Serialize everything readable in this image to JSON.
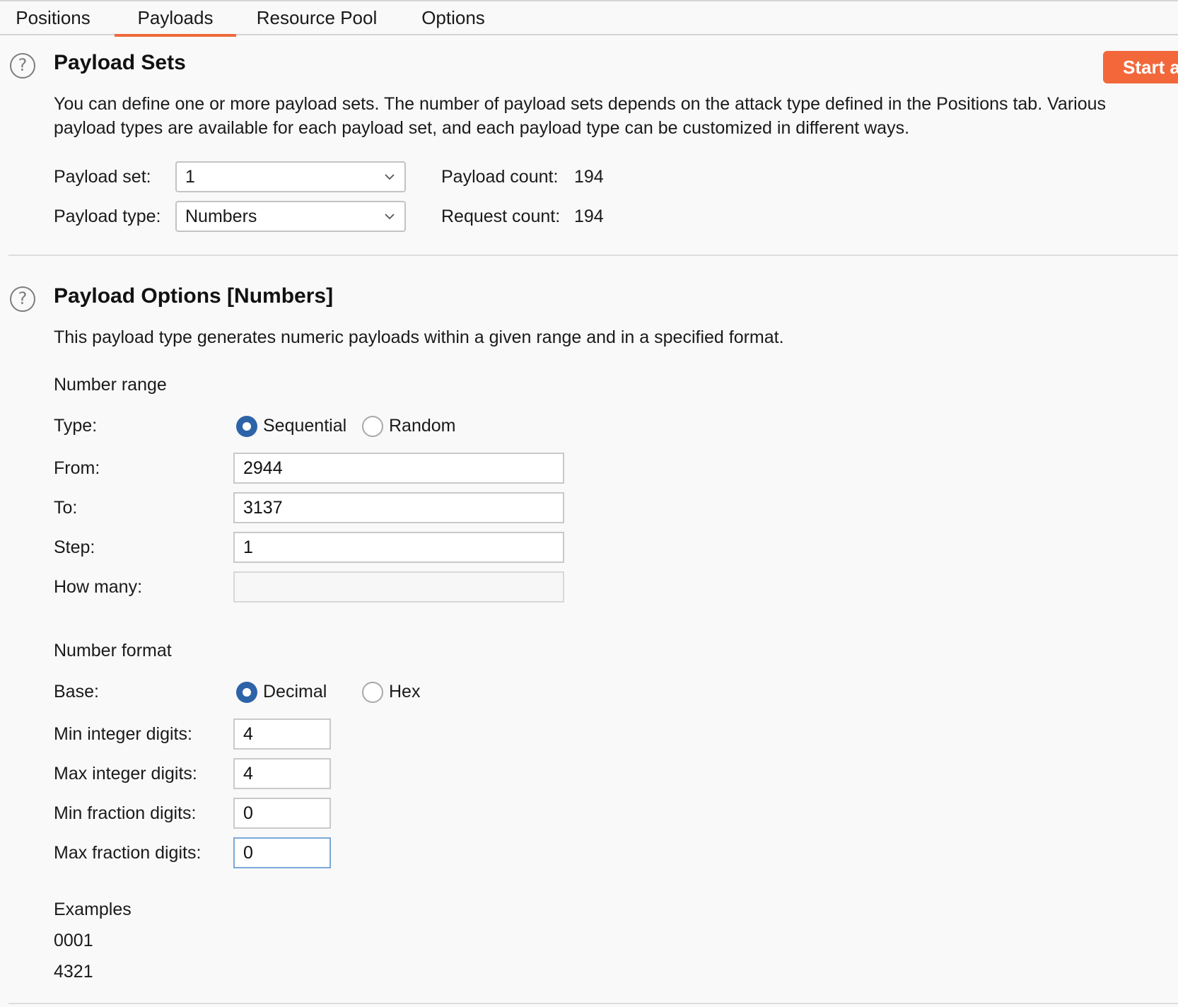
{
  "tabs": [
    {
      "label": "Positions"
    },
    {
      "label": "Payloads"
    },
    {
      "label": "Resource Pool"
    },
    {
      "label": "Options"
    }
  ],
  "payload_sets": {
    "title": "Payload Sets",
    "start_button": "Start attack",
    "description_line1": "You can define one or more payload sets. The number of payload sets depends on the attack type defined in the Positions tab. Various",
    "description_line2": "payload types are available for each payload set, and each payload type can be customized in different ways.",
    "payload_set_label": "Payload set:",
    "payload_set_value": "1",
    "payload_type_label": "Payload type:",
    "payload_type_value": "Numbers",
    "payload_count_label": "Payload count:",
    "payload_count_value": "194",
    "request_count_label": "Request count:",
    "request_count_value": "194"
  },
  "payload_options": {
    "title": "Payload Options [Numbers]",
    "description": "This payload type generates numeric payloads within a given range and in a specified format.",
    "number_range_heading": "Number range",
    "type_label": "Type:",
    "type_options": [
      "Sequential",
      "Random"
    ],
    "type_selected": "Sequential",
    "from_label": "From:",
    "from_value": "2944",
    "to_label": "To:",
    "to_value": "3137",
    "step_label": "Step:",
    "step_value": "1",
    "how_many_label": "How many:",
    "how_many_value": "",
    "number_format_heading": "Number format",
    "base_label": "Base:",
    "base_options": [
      "Decimal",
      "Hex"
    ],
    "base_selected": "Decimal",
    "min_int_label": "Min integer digits:",
    "min_int_value": "4",
    "max_int_label": "Max integer digits:",
    "max_int_value": "4",
    "min_frac_label": "Min fraction digits:",
    "min_frac_value": "0",
    "max_frac_label": "Max fraction digits:",
    "max_frac_value": "0",
    "examples_heading": "Examples",
    "examples": [
      "0001",
      "4321"
    ]
  },
  "colors": {
    "accent": "#f2683a",
    "radio_selected": "#2d63a8",
    "background": "#f9f9f9"
  }
}
